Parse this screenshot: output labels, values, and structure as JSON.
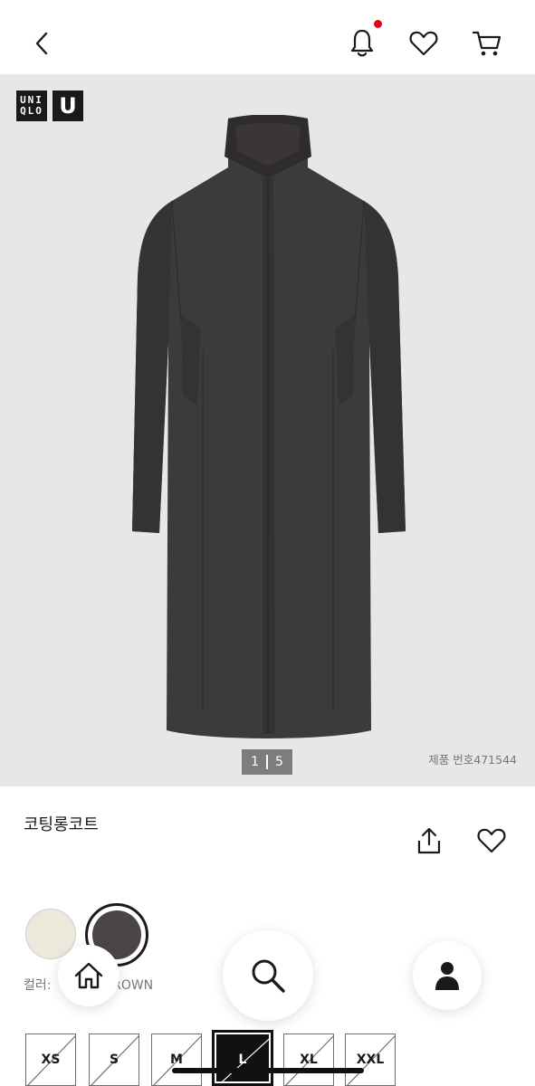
{
  "header": {
    "back_icon": "chevron-left-icon",
    "bell_icon": "bell-icon",
    "wishlist_icon": "heart-icon",
    "cart_icon": "cart-icon",
    "notification_color": "#e60012"
  },
  "gallery": {
    "brand_logo_1": "UNI QLO",
    "brand_logo_2": "U",
    "page_current": "1",
    "page_total": "5",
    "product_number": "제품 번호471544",
    "background_color": "#e6e7e8",
    "coat_color": "#3d3a3a"
  },
  "product": {
    "title": "코팅롱코트",
    "share_icon": "share-icon",
    "favorite_icon": "heart-icon"
  },
  "colors": {
    "label_prefix": "컬러:",
    "selected_name": "BROWN",
    "options": [
      {
        "color": "#ede8dc",
        "selected": false
      },
      {
        "color": "#4b4547",
        "selected": true
      }
    ]
  },
  "floating_nav": {
    "home_icon": "home-icon",
    "search_icon": "search-icon",
    "profile_icon": "user-icon"
  },
  "sizes": [
    {
      "label": "XS",
      "available": false,
      "selected": false
    },
    {
      "label": "S",
      "available": false,
      "selected": false
    },
    {
      "label": "M",
      "available": false,
      "selected": false
    },
    {
      "label": "L",
      "available": false,
      "selected": true
    },
    {
      "label": "XL",
      "available": false,
      "selected": false
    },
    {
      "label": "XXL",
      "available": false,
      "selected": false
    }
  ]
}
